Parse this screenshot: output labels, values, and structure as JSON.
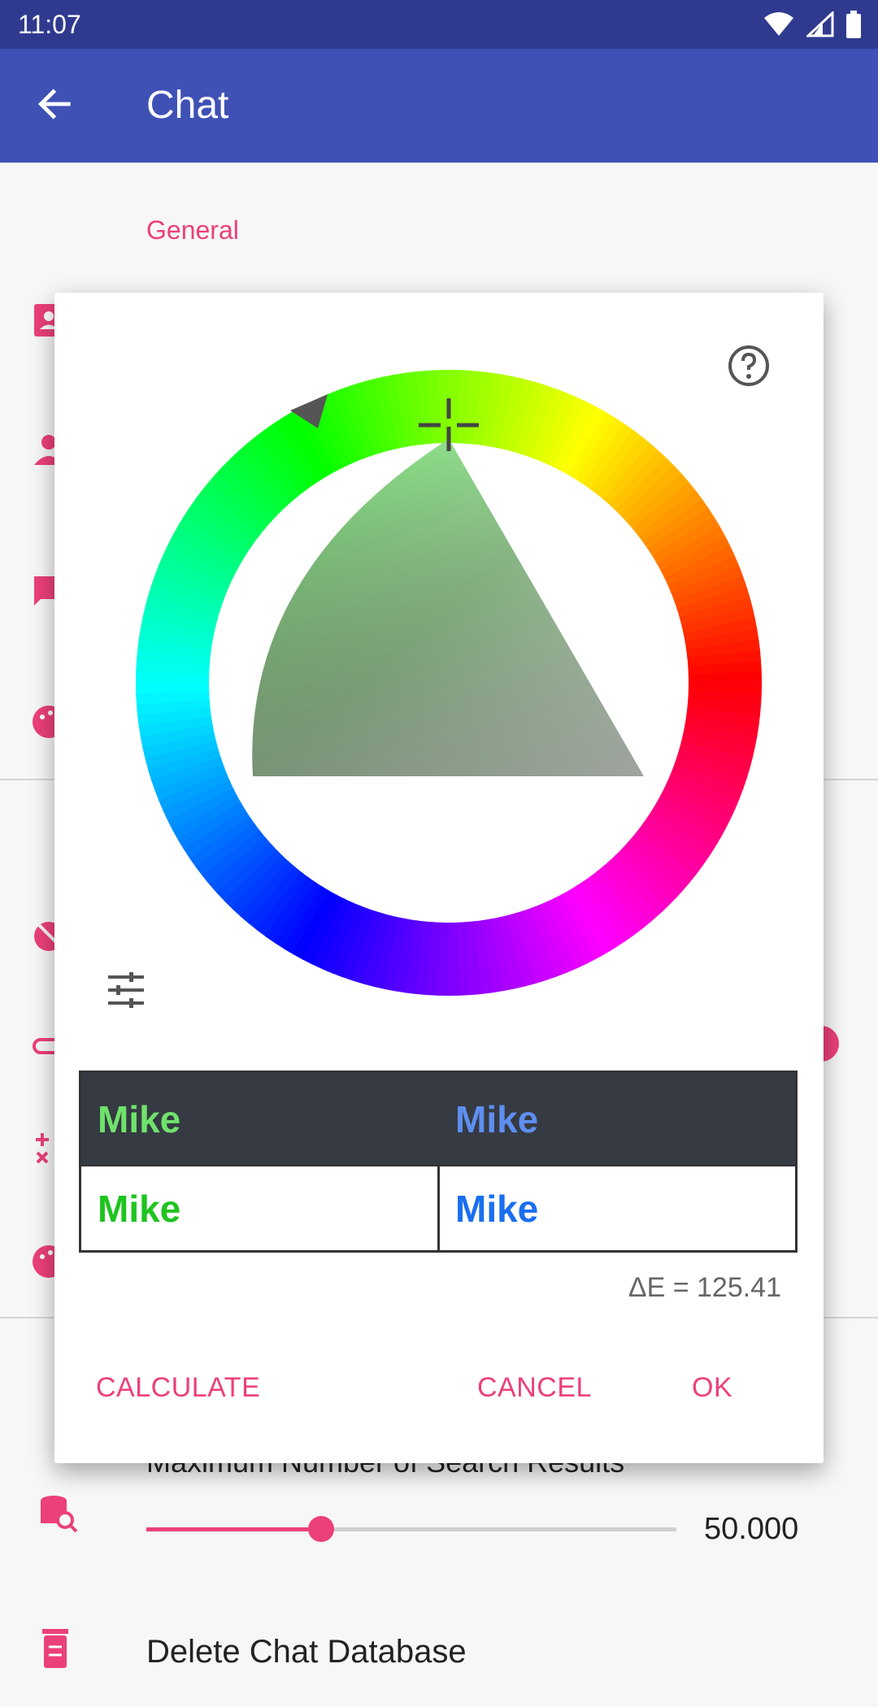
{
  "status_bar": {
    "time": "11:07"
  },
  "app_bar": {
    "title": "Chat"
  },
  "settings": {
    "section_title": "General",
    "partial_label": "Maximum Number of Search Results",
    "slider_value": "50.000",
    "slider_fraction": 0.33,
    "delete_label": "Delete Chat Database"
  },
  "dialog": {
    "preview": {
      "dark_left": "Mike",
      "dark_right": "Mike",
      "light_left": "Mike",
      "light_right": "Mike"
    },
    "delta_e": "ΔE = 125.41",
    "buttons": {
      "calculate": "CALCULATE",
      "cancel": "CANCEL",
      "ok": "OK"
    }
  },
  "colors": {
    "accent": "#ec407a",
    "primary": "#3f51b5",
    "primary_dark": "#2f3a8f",
    "preview_dark_left": "#6fe36a",
    "preview_dark_right": "#5e8ff0",
    "preview_light_left": "#1fc41f",
    "preview_light_right": "#1a6ef0"
  }
}
